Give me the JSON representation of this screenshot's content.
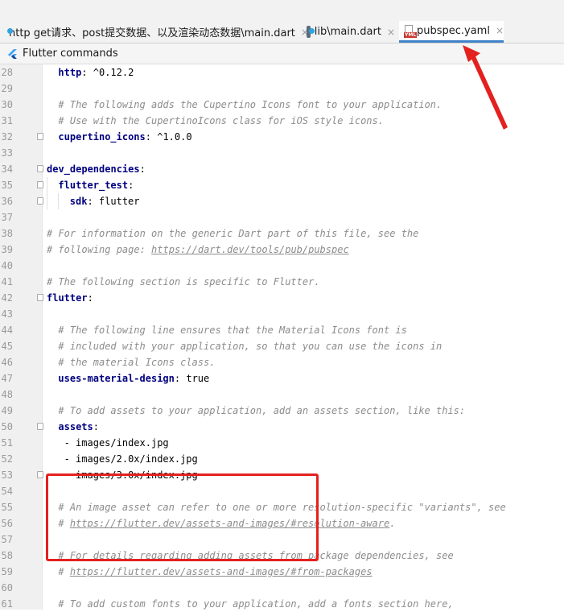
{
  "tabs": [
    {
      "label": "http get请求、post提交数据、以及渲染动态数据\\main.dart",
      "icon": "dart-file-icon",
      "active": false
    },
    {
      "label": "lib\\main.dart",
      "icon": "dart-file-icon",
      "active": false
    },
    {
      "label": "pubspec.yaml",
      "icon": "yaml-file-icon",
      "active": true
    }
  ],
  "tab_close_glyph": "×",
  "yaml_badge": "YML",
  "command_bar": {
    "label": "Flutter commands",
    "icon": "flutter-icon"
  },
  "colors": {
    "accent": "#4083c9",
    "annotation": "#e3211f",
    "comment": "#8c8c8c",
    "yaml_key": "#000080"
  },
  "lines": [
    {
      "n": "28",
      "key": "http",
      "rest": ": ^0.12.2",
      "indent": 2
    },
    {
      "n": "29"
    },
    {
      "n": "30",
      "comment": "# The following adds the Cupertino Icons font to your application.",
      "indent": 2
    },
    {
      "n": "31",
      "comment": "# Use with the CupertinoIcons class for iOS style icons.",
      "indent": 2
    },
    {
      "n": "32",
      "key": "cupertino_icons",
      "rest": ": ^1.0.0",
      "indent": 2
    },
    {
      "n": "33"
    },
    {
      "n": "34",
      "key": "dev_dependencies",
      "rest": ":",
      "indent": 0
    },
    {
      "n": "35",
      "key": "flutter_test",
      "rest": ":",
      "indent": 2
    },
    {
      "n": "36",
      "key": "sdk",
      "rest": ": flutter",
      "indent": 4
    },
    {
      "n": "37"
    },
    {
      "n": "38",
      "comment": "# For information on the generic Dart part of this file, see the",
      "indent": 0
    },
    {
      "n": "39",
      "comment": "# following page: ",
      "link": "https://dart.dev/tools/pub/pubspec",
      "indent": 0
    },
    {
      "n": "40"
    },
    {
      "n": "41",
      "comment": "# The following section is specific to Flutter.",
      "indent": 0
    },
    {
      "n": "42",
      "key": "flutter",
      "rest": ":",
      "indent": 0
    },
    {
      "n": "43"
    },
    {
      "n": "44",
      "comment": "# The following line ensures that the Material Icons font is",
      "indent": 2
    },
    {
      "n": "45",
      "comment": "# included with your application, so that you can use the icons in",
      "indent": 2
    },
    {
      "n": "46",
      "comment": "# the material Icons class.",
      "indent": 2
    },
    {
      "n": "47",
      "key": "uses-material-design",
      "rest": ": true",
      "indent": 2
    },
    {
      "n": "48"
    },
    {
      "n": "49",
      "comment": "# To add assets to your application, add an assets section, like this:",
      "indent": 2
    },
    {
      "n": "50",
      "key": "assets",
      "rest": ":",
      "indent": 2
    },
    {
      "n": "51",
      "plain": "- images/index.jpg",
      "indent": 3
    },
    {
      "n": "52",
      "plain": "- images/2.0x/index.jpg",
      "indent": 3
    },
    {
      "n": "53",
      "plain": "- images/3.0x/index.jpg",
      "indent": 3
    },
    {
      "n": "54"
    },
    {
      "n": "55",
      "comment": "# An image asset can refer to one or more resolution-specific \"variants\", see",
      "indent": 2
    },
    {
      "n": "56",
      "comment": "# ",
      "link": "https://flutter.dev/assets-and-images/#resolution-aware",
      "tail": ".",
      "indent": 2
    },
    {
      "n": "57"
    },
    {
      "n": "58",
      "comment": "# For details regarding adding assets from package dependencies, see",
      "indent": 2
    },
    {
      "n": "59",
      "comment": "# ",
      "link": "https://flutter.dev/assets-and-images/#from-packages",
      "indent": 2
    },
    {
      "n": "60"
    },
    {
      "n": "61",
      "comment": "# To add custom fonts to your application, add a fonts section here,",
      "indent": 2
    }
  ]
}
